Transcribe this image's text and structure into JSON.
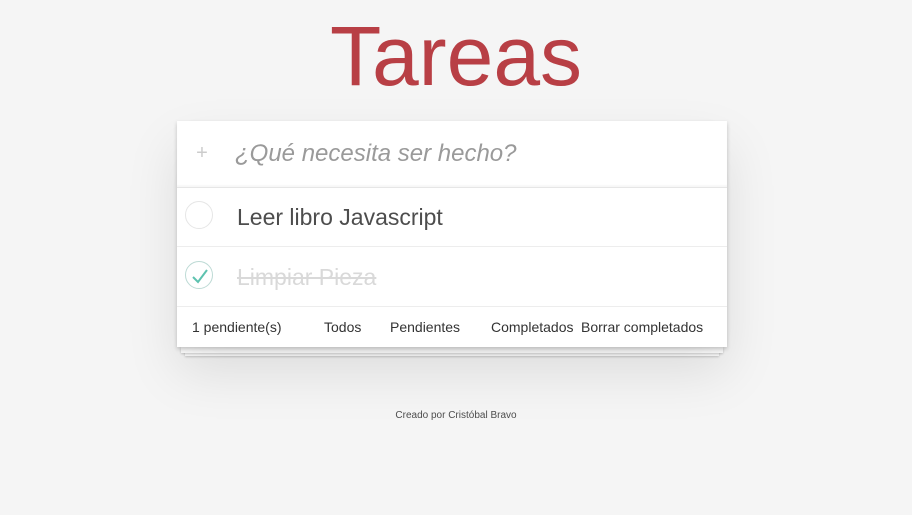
{
  "app": {
    "title": "Tareas"
  },
  "new_todo": {
    "placeholder": "¿Qué necesita ser hecho?",
    "value": "",
    "toggle_icon": "plus-icon"
  },
  "todos": [
    {
      "text": "Leer libro Javascript",
      "completed": false
    },
    {
      "text": "Limpiar Pieza",
      "completed": true
    }
  ],
  "footer": {
    "count_label": "1 pendiente(s)",
    "filters": {
      "all": "Todos",
      "active": "Pendientes",
      "completed": "Completados"
    },
    "clear_label": "Borrar completados"
  },
  "credit": "Creado por Cristóbal Bravo",
  "colors": {
    "title": "#b83f45",
    "check": "#5dc2af",
    "background": "#f5f5f5"
  }
}
